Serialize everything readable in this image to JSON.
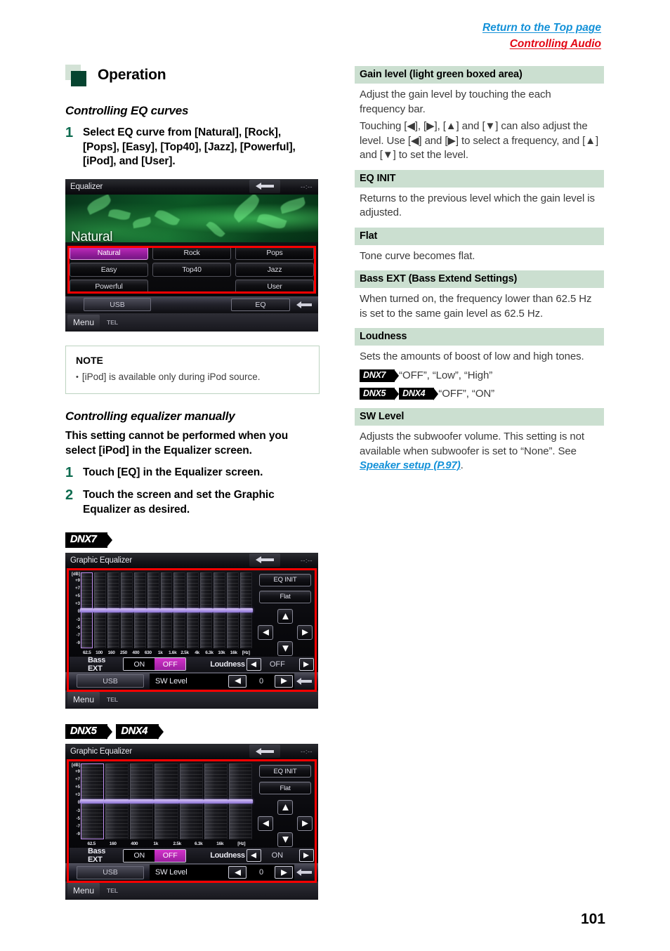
{
  "header": {
    "top_link": "Return to the Top page",
    "breadcrumb": "Controlling Audio"
  },
  "page_number": "101",
  "left_column": {
    "section_title": "Operation",
    "eq_curves": {
      "heading": "Controlling EQ curves",
      "step_number": "1",
      "step_text": "Select EQ curve from [Natural], [Rock], [Pops], [Easy], [Top40], [Jazz], [Powerful], [iPod], and [User]."
    },
    "note": {
      "title": "NOTE",
      "item": "[iPod] is available only during iPod source."
    },
    "manual_eq": {
      "heading": "Controlling equalizer manually",
      "intro": "This setting cannot be performed when you select [iPod] in the Equalizer screen.",
      "steps": [
        {
          "num": "1",
          "text": "Touch [EQ] in the Equalizer screen."
        },
        {
          "num": "2",
          "text": "Touch the screen and set the Graphic Equalizer as desired."
        }
      ]
    },
    "badges": {
      "dnx7": "DNX7",
      "dnx5": "DNX5",
      "dnx4": "DNX4"
    }
  },
  "right_column": {
    "entries": [
      {
        "term": "Gain level (light green boxed area)",
        "paragraphs": [
          "Adjust the gain level by touching the each frequency bar.",
          "Touching [◀], [▶], [▲] and [▼] can also adjust the level. Use [◀] and [▶] to select a frequency, and [▲] and [▼] to set the level."
        ]
      },
      {
        "term": "EQ INIT",
        "paragraphs": [
          "Returns to the previous level which the gain level is adjusted."
        ]
      },
      {
        "term": "Flat",
        "paragraphs": [
          "Tone curve becomes flat."
        ]
      },
      {
        "term": "Bass EXT (Bass Extend Settings)",
        "paragraphs": [
          "When turned on, the frequency lower than 62.5 Hz is set to the same gain level as 62.5 Hz."
        ]
      },
      {
        "term": "Loudness",
        "paragraphs": [
          "Sets the amounts of boost of low and high tones."
        ],
        "device_values": [
          {
            "badges": [
              "DNX7"
            ],
            "values": "“OFF”, “Low”, “High”"
          },
          {
            "badges": [
              "DNX5",
              "DNX4"
            ],
            "values": "“OFF”, “ON”"
          }
        ]
      },
      {
        "term": "SW Level",
        "paragraphs": [
          "Adjusts the subwoofer volume. This setting is not available when subwoofer is set to “None”."
        ],
        "see_prefix": "See ",
        "link": "Speaker setup (P.97)",
        "see_suffix": "."
      }
    ]
  },
  "eq_preset_screen": {
    "title": "Equalizer",
    "clock": "--:--",
    "current_curve": "Natural",
    "buttons": [
      "Natural",
      "Rock",
      "Pops",
      "Easy",
      "Top40",
      "Jazz",
      "Powerful",
      "",
      "User"
    ],
    "selected_button": "Natural",
    "source_label": "USB",
    "eq_label": "EQ",
    "menu_label": "Menu",
    "tel_label": "TEL"
  },
  "graphic_eq_dnx7": {
    "title": "Graphic Equalizer",
    "clock": "--:--",
    "db_labels": [
      "[dB]",
      "+9",
      "+7",
      "+5",
      "+3",
      "0",
      "-3",
      "-5",
      "-7",
      "-9"
    ],
    "frequencies": [
      "62.5",
      "100",
      "160",
      "250",
      "400",
      "630",
      "1k",
      "1.6k",
      "2.5k",
      "4k",
      "6.3k",
      "10k",
      "16k",
      "[Hz]"
    ],
    "band_count": 13,
    "selected_band_index": 0,
    "gain_values": [
      0,
      0,
      0,
      0,
      0,
      0,
      0,
      0,
      0,
      0,
      0,
      0,
      0
    ],
    "eq_init_label": "EQ INIT",
    "flat_label": "Flat",
    "bass_ext_label": "Bass EXT",
    "bass_ext_on": "ON",
    "bass_ext_off": "OFF",
    "bass_ext_selected": "OFF",
    "loudness_label": "Loudness",
    "loudness_value": "OFF",
    "source_label": "USB",
    "sw_level_label": "SW Level",
    "sw_level_value": "0",
    "menu_label": "Menu",
    "tel_label": "TEL"
  },
  "graphic_eq_dnx5": {
    "title": "Graphic Equalizer",
    "clock": "--:--",
    "db_labels": [
      "[dB]",
      "+9",
      "+7",
      "+5",
      "+3",
      "0",
      "-3",
      "-5",
      "-7",
      "-9"
    ],
    "frequencies": [
      "62.5",
      "160",
      "400",
      "1k",
      "2.5k",
      "6.3k",
      "16k",
      "[Hz]"
    ],
    "band_count": 7,
    "selected_band_index": 0,
    "gain_values": [
      0,
      0,
      0,
      0,
      0,
      0,
      0
    ],
    "eq_init_label": "EQ INIT",
    "flat_label": "Flat",
    "bass_ext_label": "Bass EXT",
    "bass_ext_on": "ON",
    "bass_ext_off": "OFF",
    "bass_ext_selected": "OFF",
    "loudness_label": "Loudness",
    "loudness_value": "ON",
    "source_label": "USB",
    "sw_level_label": "SW Level",
    "sw_level_value": "0",
    "menu_label": "Menu",
    "tel_label": "TEL"
  },
  "colors": {
    "top_link_blue": "#1391d8",
    "breadcrumb_red": "#e30613",
    "def_header_green": "#cbdfd0",
    "step_number_green": "#0d6b4f",
    "heading_square_dark": "#064430",
    "heading_square_light": "#d3e2d6",
    "frame_red": "#ff0000",
    "accent_magenta": "#c72fc0"
  }
}
